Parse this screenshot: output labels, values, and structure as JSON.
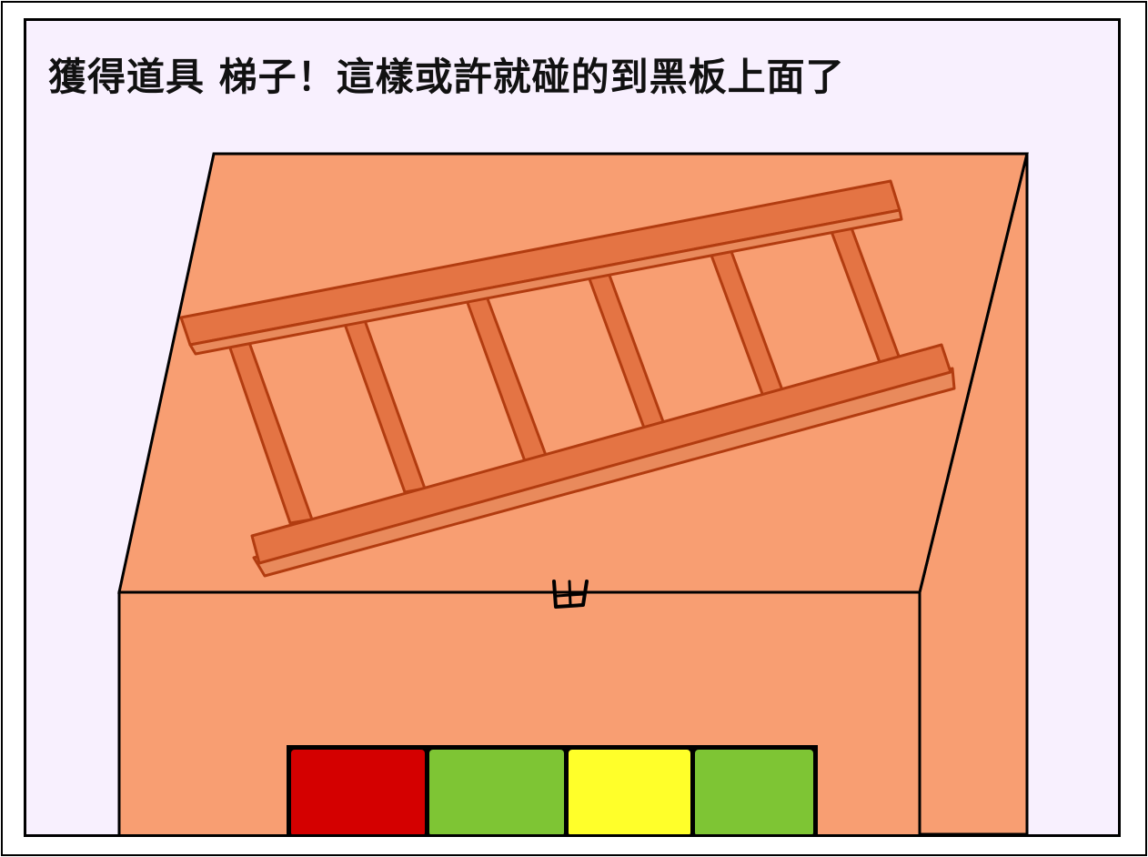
{
  "dialog": {
    "message": "獲得道具 梯子！這樣或許就碰的到黑板上面了"
  },
  "item": {
    "name": "梯子",
    "icon": "ladder-icon",
    "rungs": 6,
    "color": "#e47444",
    "outline": "#b23c10"
  },
  "cabinet": {
    "color": "#f89e72",
    "knob_icon": "drawer-handle-icon"
  },
  "color_buttons": [
    {
      "name": "red",
      "color": "#d40000"
    },
    {
      "name": "green",
      "color": "#7ec534"
    },
    {
      "name": "yellow",
      "color": "#ffff2a"
    },
    {
      "name": "green",
      "color": "#7ec534"
    }
  ]
}
